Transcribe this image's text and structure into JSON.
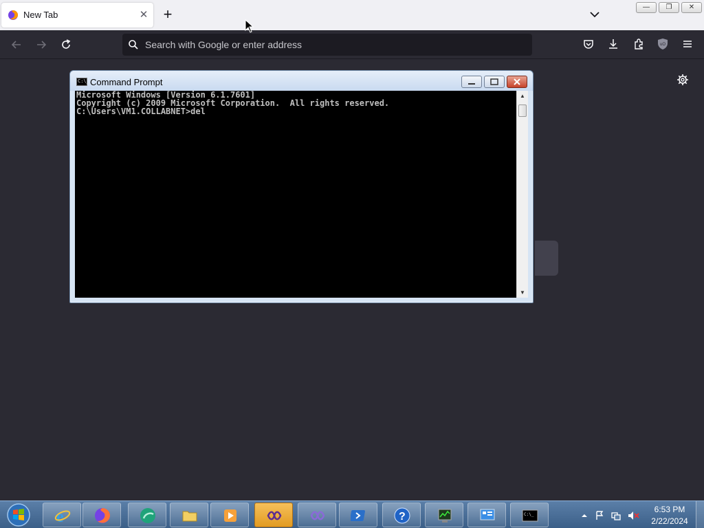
{
  "browser": {
    "tab": {
      "title": "New Tab",
      "close": "✕"
    },
    "new_tab": "+",
    "window_controls": {
      "minimize": "—",
      "restore": "❐",
      "close": "✕"
    },
    "search": {
      "placeholder": "Search with Google or enter address"
    },
    "toolbar_icons": [
      "pocket-icon",
      "downloads-icon",
      "extensions-icon",
      "ublock-icon",
      "menu-icon"
    ]
  },
  "cmd_window": {
    "title": "Command Prompt",
    "icon_text": "C:\\_",
    "lines": [
      "Microsoft Windows [Version 6.1.7601]",
      "Copyright (c) 2009 Microsoft Corporation.  All rights reserved.",
      "",
      "C:\\Users\\VM1.COLLABNET>del"
    ],
    "buttons": {
      "minimize": "—",
      "maximize": "□",
      "close": "✕"
    }
  },
  "taskbar": {
    "apps": [
      "Start",
      "Internet Explorer",
      "Firefox",
      "Browser",
      "Windows Explorer",
      "Media Player",
      "Visual Studio",
      "Visual Studio 2",
      "PowerShell",
      "Help and Support",
      "Task Manager",
      "Control Panel",
      "Command Prompt"
    ],
    "clock": {
      "time": "6:53 PM",
      "date": "2/22/2024"
    }
  },
  "colors": {
    "browser_bg": "#2b2a33",
    "tabstrip": "#f0f0f4",
    "taskbar": "#4a6e97",
    "console": "#000000"
  }
}
